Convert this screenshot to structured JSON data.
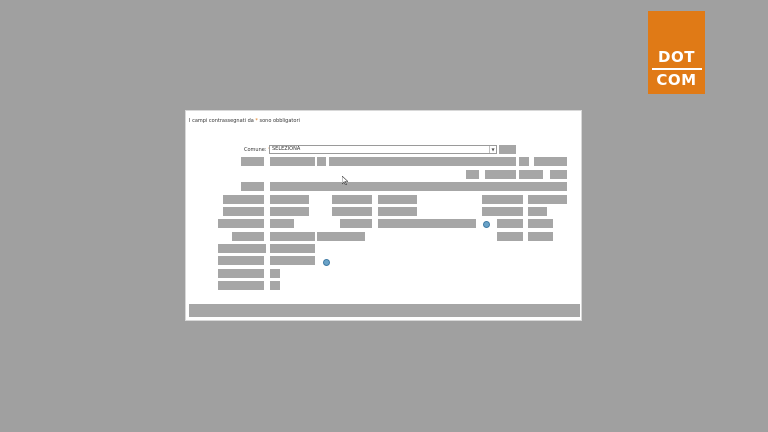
{
  "logo": {
    "line1": "DOT",
    "line2": "COM",
    "color": "#e07a16"
  },
  "form": {
    "required_note_prefix": "I campi contrassegnati da",
    "required_star": "*",
    "required_note_suffix": "sono obbligatori",
    "comune_label": "Comune:",
    "comune_star": "*",
    "comune_value": "SELEZIONA"
  },
  "colors": {
    "background": "#a0a0a0",
    "panel": "#ffffff",
    "placeholder_block": "#a6a6a6"
  }
}
